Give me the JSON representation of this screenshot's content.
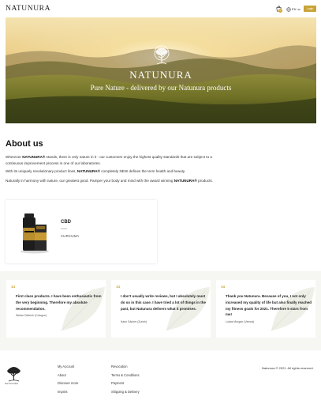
{
  "header": {
    "logo": "NATUNURA",
    "cart_count": "0",
    "language": "EN",
    "login_label": "Login"
  },
  "hero": {
    "brand": "NATUNURA",
    "tagline": "Pure Nature - delivered by our Natunura products"
  },
  "about": {
    "title": "About us",
    "p1_a": "Wherever ",
    "p1_brand": "NATUNURA®",
    "p1_b": " stands, there is only nature in it - our customers enjoy the highest quality standards that are subject to a continuous improvement process in one of our laboratories.",
    "p2_a": "With its uniquely revolutionary product lines, ",
    "p2_brand": "NATUNURA®",
    "p2_b": " completely NEW defines the term health and beauty.",
    "p3_a": "Naturally in harmony with nature, our greatest good. Pamper your body and mind with the award winning ",
    "p3_brand": "NATUNURA®",
    "p3_b": " products."
  },
  "product": {
    "name": "CBD",
    "brand": "CURCUMA"
  },
  "testimonials": [
    {
      "quote": "First class products. I have been enthusiastic from the very beginning. Therefore my absolute recommendation.",
      "author": "Stefan Dietrich (Cologne)"
    },
    {
      "quote": "I don't usually write reviews, but I absolutely must do so in this case. I have tried a lot of things in the past, but Natunura delivers what it promises.",
      "author": "Karin Sächer (Zurich)"
    },
    {
      "quote": "Thank you Natunura. Because of you, I not only increased my quality of life but also finally reached my fitness goals for 2021. Therefore 5 stars from me!",
      "author": "Lukas Morgan (Vienna)"
    }
  ],
  "footer": {
    "logo_text": "NATUNURA",
    "col1": [
      "My Account",
      "About",
      "Discover more",
      "Imprint"
    ],
    "col2": [
      "Revocation",
      "Terms & Conditions",
      "Payment",
      "Shipping & Delivery"
    ],
    "copyright": "Natunura © 2021. All rights reserved."
  },
  "colors": {
    "accent_gold": "#c9a338",
    "band_bg": "#f6f6f3"
  }
}
